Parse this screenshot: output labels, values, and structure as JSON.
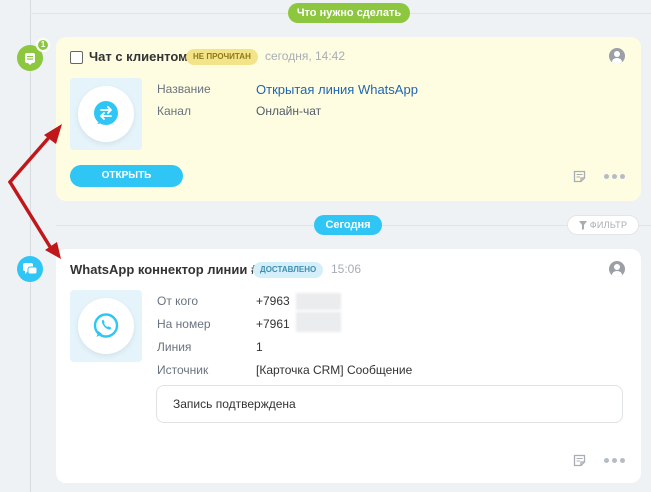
{
  "colors": {
    "green": "#8dc63f",
    "blue": "#2fc6f6",
    "arrow": "#c0171a"
  },
  "timeline": {
    "todo_label": "Что нужно сделать",
    "today_label": "Сегодня",
    "filter_label": "ФИЛЬТР",
    "todo_badge_count": "1"
  },
  "activity": {
    "title": "Чат с клиентом",
    "status": "НЕ ПРОЧИТАН",
    "time": "сегодня, 14:42",
    "icon": "open-line-icon",
    "fields": [
      {
        "label": "Название",
        "value": "Открытая линия WhatsApp"
      },
      {
        "label": "Канал",
        "value": "Онлайн-чат"
      }
    ],
    "open_button": "ОТКРЫТЬ"
  },
  "message": {
    "title": "WhatsApp коннектор линии #1",
    "status": "ДОСТАВЛЕНО",
    "time": "15:06",
    "icon": "whatsapp-icon",
    "fields": [
      {
        "label": "От кого",
        "value": "+7963"
      },
      {
        "label": "На номер",
        "value": "+7961"
      },
      {
        "label": "Линия",
        "value": "1"
      },
      {
        "label": "Источник",
        "value": "[Карточка CRM] Сообщение"
      }
    ],
    "comment": "Запись подтверждена"
  }
}
